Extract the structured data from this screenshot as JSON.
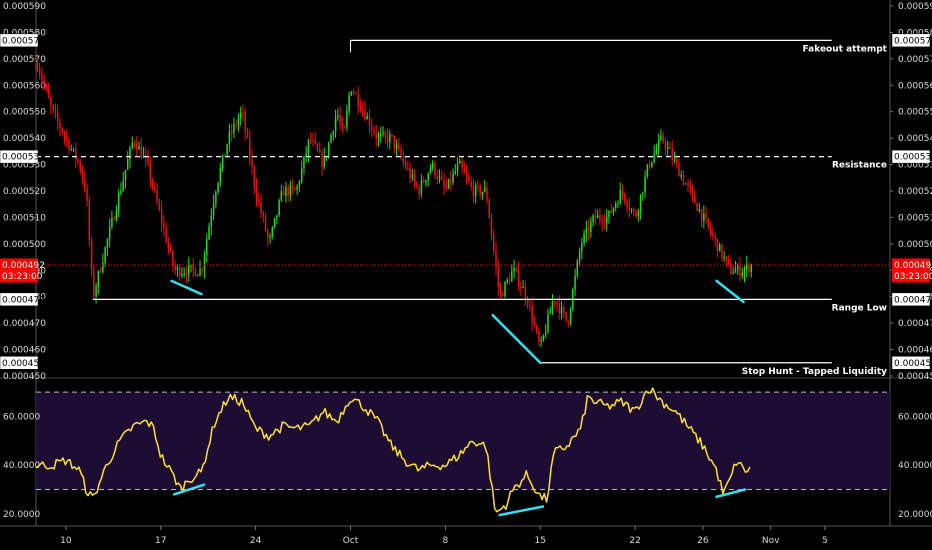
{
  "chart_data": [
    {
      "type": "candlestick",
      "panel": "price",
      "ylim": [
        0.00045,
        0.00059
      ],
      "yticks": [
        "0.000590",
        "0.000580",
        "0.000570",
        "0.000560",
        "0.000550",
        "0.000540",
        "0.000530",
        "0.000520",
        "0.000510",
        "0.000500",
        "0.000490",
        "0.000480",
        "0.000470",
        "0.000460",
        "0.000450"
      ],
      "x_tick_labels": [
        "10",
        "17",
        "24",
        "Oct",
        "8",
        "15",
        "22",
        "26",
        "Nov",
        "5"
      ],
      "x_tick_positions": [
        10,
        17,
        24,
        31,
        38,
        45,
        52,
        57,
        62,
        66
      ],
      "xlim": [
        7.8,
        70.8
      ],
      "current_price": {
        "value": 0.000492,
        "label": "0.000492",
        "timer": "03:23:00",
        "color": "#ff0000"
      },
      "price_tags": [
        {
          "value": 0.000577,
          "label": "0.000577"
        },
        {
          "value": 0.000533,
          "label": "0.000533"
        },
        {
          "value": 0.000479,
          "label": "0.000479"
        },
        {
          "value": 0.000455,
          "label": "0.000455"
        }
      ],
      "levels": [
        {
          "name": "Fakeout attempt",
          "value": 0.000577,
          "x_start": 31,
          "x_end": 66.5,
          "style": "solid"
        },
        {
          "name": "Resistance",
          "value": 0.000533,
          "x_start": 7.8,
          "x_end": 66.5,
          "style": "dashed"
        },
        {
          "name": "Range Low",
          "value": 0.000479,
          "x_start": 12,
          "x_end": 66.5,
          "style": "solid"
        },
        {
          "name": "Stop Hunt - Tapped Liquidity",
          "value": 0.000455,
          "x_start": 45,
          "x_end": 66.5,
          "style": "solid"
        }
      ],
      "trendlines": [
        {
          "x1": 17.8,
          "y1": 0.000486,
          "x2": 20.0,
          "y2": 0.000481,
          "color": "#33e0f0"
        },
        {
          "x1": 41.5,
          "y1": 0.000473,
          "x2": 45.0,
          "y2": 0.000455,
          "color": "#33e0f0"
        },
        {
          "x1": 58.0,
          "y1": 0.000486,
          "x2": 60.0,
          "y2": 0.000478,
          "color": "#33e0f0"
        }
      ],
      "keypoints": [
        [
          7.8,
          0.00057
        ],
        [
          9,
          0.00055
        ],
        [
          10,
          0.00054
        ],
        [
          11,
          0.00053
        ],
        [
          11.5,
          0.00052
        ],
        [
          12,
          0.00048
        ],
        [
          13,
          0.0005
        ],
        [
          14,
          0.00052
        ],
        [
          15,
          0.00054
        ],
        [
          16,
          0.00053
        ],
        [
          17,
          0.00051
        ],
        [
          18,
          0.00049
        ],
        [
          19,
          0.00049
        ],
        [
          20,
          0.00049
        ],
        [
          21,
          0.00052
        ],
        [
          22,
          0.00054
        ],
        [
          23,
          0.00055
        ],
        [
          24,
          0.00052
        ],
        [
          25,
          0.0005
        ],
        [
          26,
          0.00052
        ],
        [
          27,
          0.00052
        ],
        [
          28,
          0.00054
        ],
        [
          29,
          0.00053
        ],
        [
          30,
          0.00055
        ],
        [
          30.5,
          0.00054
        ],
        [
          31,
          0.00056
        ],
        [
          32,
          0.00055
        ],
        [
          33,
          0.00054
        ],
        [
          34,
          0.00054
        ],
        [
          35,
          0.00053
        ],
        [
          36,
          0.00052
        ],
        [
          37,
          0.00053
        ],
        [
          38,
          0.00052
        ],
        [
          39,
          0.00053
        ],
        [
          40,
          0.00052
        ],
        [
          41,
          0.00052
        ],
        [
          42,
          0.00048
        ],
        [
          43,
          0.00049
        ],
        [
          44,
          0.00048
        ],
        [
          45,
          0.00046
        ],
        [
          46,
          0.00048
        ],
        [
          47,
          0.00047
        ],
        [
          48,
          0.0005
        ],
        [
          49,
          0.00051
        ],
        [
          50,
          0.00051
        ],
        [
          51,
          0.00052
        ],
        [
          52,
          0.00051
        ],
        [
          53,
          0.00053
        ],
        [
          54,
          0.00054
        ],
        [
          55,
          0.00053
        ],
        [
          56,
          0.00052
        ],
        [
          57,
          0.00051
        ],
        [
          58,
          0.0005
        ],
        [
          59,
          0.00049
        ],
        [
          60,
          0.00049
        ],
        [
          60.6,
          0.000492
        ]
      ]
    },
    {
      "type": "line",
      "panel": "rsi",
      "ylim": [
        15,
        75
      ],
      "yticks": [
        "60.0000",
        "40.0000",
        "20.0000"
      ],
      "bands": [
        70,
        30
      ],
      "band_fill": "#1e0d33",
      "line_color": "#ffe030",
      "trendlines": [
        {
          "x1": 18,
          "y1": 28,
          "x2": 20.2,
          "y2": 32,
          "color": "#33e0f0"
        },
        {
          "x1": 42,
          "y1": 19.5,
          "x2": 45.2,
          "y2": 23,
          "color": "#33e0f0"
        },
        {
          "x1": 58,
          "y1": 27,
          "x2": 60.1,
          "y2": 30,
          "color": "#33e0f0"
        }
      ],
      "keypoints": [
        [
          7.8,
          40
        ],
        [
          9,
          40
        ],
        [
          10,
          42
        ],
        [
          11,
          38
        ],
        [
          11.5,
          30
        ],
        [
          12,
          26
        ],
        [
          13,
          40
        ],
        [
          14,
          50
        ],
        [
          15,
          56
        ],
        [
          16,
          58
        ],
        [
          16.5,
          55
        ],
        [
          17,
          44
        ],
        [
          18,
          35
        ],
        [
          18.5,
          30
        ],
        [
          19,
          34
        ],
        [
          20,
          37
        ],
        [
          21,
          58
        ],
        [
          22,
          68
        ],
        [
          23,
          66
        ],
        [
          24,
          55
        ],
        [
          25,
          52
        ],
        [
          26,
          56
        ],
        [
          27,
          55
        ],
        [
          28,
          56
        ],
        [
          29,
          62
        ],
        [
          30,
          58
        ],
        [
          31,
          68
        ],
        [
          32,
          64
        ],
        [
          33,
          58
        ],
        [
          34,
          48
        ],
        [
          35,
          42
        ],
        [
          36,
          38
        ],
        [
          37,
          40
        ],
        [
          38,
          40
        ],
        [
          39,
          44
        ],
        [
          40,
          50
        ],
        [
          41,
          48
        ],
        [
          41.7,
          20
        ],
        [
          42.5,
          24
        ],
        [
          43,
          30
        ],
        [
          44,
          36
        ],
        [
          45,
          27
        ],
        [
          45.5,
          26
        ],
        [
          46,
          45
        ],
        [
          47,
          48
        ],
        [
          48,
          55
        ],
        [
          48.5,
          68
        ],
        [
          49,
          66
        ],
        [
          50,
          64
        ],
        [
          51,
          66
        ],
        [
          52,
          62
        ],
        [
          53,
          72
        ],
        [
          54,
          66
        ],
        [
          55,
          62
        ],
        [
          56,
          55
        ],
        [
          57,
          48
        ],
        [
          58,
          38
        ],
        [
          58.5,
          28
        ],
        [
          59,
          34
        ],
        [
          59.5,
          42
        ],
        [
          60,
          38
        ],
        [
          60.6,
          38
        ]
      ]
    }
  ]
}
